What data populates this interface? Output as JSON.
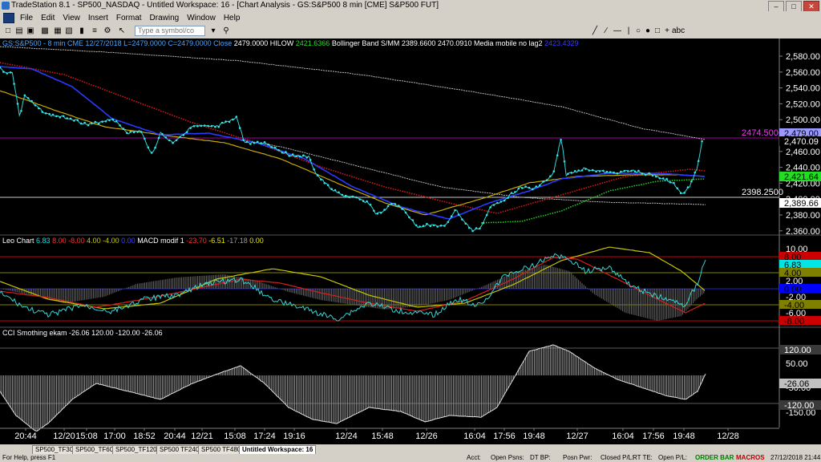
{
  "window": {
    "title": "TradeStation 8.1 - SP500_NASDAQ - Untitled Workspace: 16 - [Chart Analysis - GS:S&P500  8 min  [CME] S&P500 FUT]",
    "icon": "tradestation-icon"
  },
  "menu": [
    "File",
    "Edit",
    "View",
    "Insert",
    "Format",
    "Drawing",
    "Window",
    "Help"
  ],
  "toolbar": {
    "symbol_placeholder": "Type a symbol/co"
  },
  "price_panel": {
    "header": [
      {
        "text": "GS:S&P500 - 8 min   CME   12/27/2018  L=2479.0000  C=2479.0000  Close",
        "color": "#4aa3ff"
      },
      {
        "text": "2479.0000",
        "color": "#ffffff"
      },
      {
        "text": "HILOW",
        "color": "#ffffff"
      },
      {
        "text": "2421.6366",
        "color": "#22dd22"
      },
      {
        "text": "Bollinger Band S/MM",
        "color": "#ffffff"
      },
      {
        "text": "2389.6600",
        "color": "#ffffff"
      },
      {
        "text": "2470.0910",
        "color": "#ffffff"
      },
      {
        "text": "Media mobile no lag2",
        "color": "#ffffff"
      },
      {
        "text": "2423.4329",
        "color": "#3a3aff"
      }
    ],
    "ticks": [
      "2,580.00",
      "2,560.00",
      "2,540.00",
      "2,520.00",
      "2,500.00",
      "2,480.00",
      "2,460.00",
      "2,440.00",
      "2,420.00",
      "2,400.00",
      "2,380.00",
      "2,360.00"
    ],
    "hline_magenta_label": "2474.5000",
    "hline_white_label": "2398.2500",
    "markers": [
      {
        "text": "2,479.00",
        "bg": "#9999ff",
        "fg": "#000000"
      },
      {
        "text": "2,470.09",
        "bg": "#000000",
        "fg": "#ffffff"
      },
      {
        "text": "2,421.64",
        "bg": "#22dd22",
        "fg": "#000000"
      },
      {
        "text": "2,389.66",
        "bg": "#ffffff",
        "fg": "#000000"
      }
    ]
  },
  "leo_panel": {
    "header": [
      {
        "text": "Leo Chart",
        "color": "#ffffff"
      },
      {
        "text": "6.83",
        "color": "#00e5e5"
      },
      {
        "text": "8.00",
        "color": "#ff3030"
      },
      {
        "text": "-8.00",
        "color": "#ff3030"
      },
      {
        "text": "4.00",
        "color": "#c8c800"
      },
      {
        "text": "-4.00",
        "color": "#c8c800"
      },
      {
        "text": "0.00",
        "color": "#4040ff"
      },
      {
        "text": "MACD modif 1",
        "color": "#ffffff"
      },
      {
        "text": "-23.70",
        "color": "#ff3030"
      },
      {
        "text": "-6.51",
        "color": "#e8e800"
      },
      {
        "text": "-17.18",
        "color": "#9a9a9a"
      },
      {
        "text": "0.00",
        "color": "#e8e800"
      }
    ],
    "ticks": [
      "10.00",
      "2.00",
      "-2.00",
      "-6.00"
    ],
    "markers": [
      {
        "text": "8.00",
        "bg": "#cc0000",
        "fg": "#000000"
      },
      {
        "text": "6.83",
        "bg": "#00e5e5",
        "fg": "#000000"
      },
      {
        "text": "4.00",
        "bg": "#808000",
        "fg": "#000000"
      },
      {
        "text": "0.00",
        "bg": "#0000ff",
        "fg": "#000000"
      },
      {
        "text": "-4.00",
        "bg": "#808000",
        "fg": "#000000"
      },
      {
        "text": "-8.00",
        "bg": "#cc0000",
        "fg": "#000000"
      }
    ]
  },
  "cci_panel": {
    "header": [
      {
        "text": "CCI Smothing ekam",
        "color": "#ffffff"
      },
      {
        "text": "-26.06",
        "color": "#ffffff"
      },
      {
        "text": "120.00",
        "color": "#ffffff"
      },
      {
        "text": "-120.00",
        "color": "#ffffff"
      },
      {
        "text": "-26.06",
        "color": "#ffffff"
      }
    ],
    "ticks": [
      "50.00",
      "-50.00",
      "-150.00"
    ],
    "markers": [
      {
        "text": "120.00",
        "bg": "#3a3a3a",
        "fg": "#ffffff"
      },
      {
        "text": "-26.06",
        "bg": "#c0c0c0",
        "fg": "#000000"
      },
      {
        "text": "-120.00",
        "bg": "#3a3a3a",
        "fg": "#ffffff"
      }
    ]
  },
  "time_axis": [
    "20:44",
    "12/20",
    "15:08",
    "17:00",
    "18:52",
    "20:44",
    "12/21",
    "15:08",
    "17:24",
    "19:16",
    "12/24",
    "15:48",
    "12/26",
    "16:04",
    "17:56",
    "19:48",
    "12/27",
    "16:04",
    "17:56",
    "19:48",
    "12/28"
  ],
  "workspace_tabs": [
    "SP500_TF30",
    "SP500_TF60",
    "SP500_TF120",
    "SP500 TF240",
    "SP500 TF480",
    "Untitled Workspace: 16"
  ],
  "status": {
    "help": "For Help, press F1",
    "acct": "Acct:",
    "open_psns": "Open Psns:",
    "dt_bp": "DT BP:",
    "posn_pwr": "Posn Pwr:",
    "closed_pl": "Closed P/L:",
    "rt_te": "RT TE:",
    "open_pl": "Open P/L:",
    "order_bar": "ORDER BAR",
    "macros": "MACROS",
    "datetime": "27/12/2018 21:44"
  }
}
